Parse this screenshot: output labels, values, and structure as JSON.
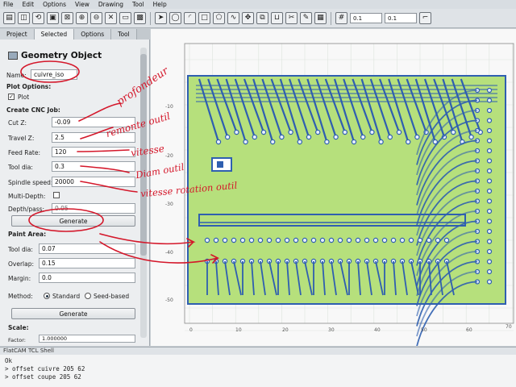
{
  "menu": [
    "File",
    "Edit",
    "Options",
    "View",
    "Drawing",
    "Tool",
    "Help"
  ],
  "toolbar": {
    "field_1": "0.1",
    "field_2": "0.1"
  },
  "tabs": [
    "Project",
    "Selected",
    "Options",
    "Tool"
  ],
  "panel": {
    "title": "Geometry Object",
    "name_label": "Name:",
    "name_value": "cuivre_iso",
    "plot_options": "Plot Options:",
    "plot_label": "Plot",
    "create_cnc": "Create CNC Job:",
    "cut_z_label": "Cut Z:",
    "cut_z": "-0.09",
    "travel_z_label": "Travel Z:",
    "travel_z": "2.5",
    "feed_rate_label": "Feed Rate:",
    "feed_rate": "120",
    "tool_dia_label": "Tool dia:",
    "tool_dia": "0.3",
    "spindle_label": "Spindle speed:",
    "spindle": "20000",
    "multidepth_label": "Multi-Depth:",
    "depth_pass_label": "Depth/pass:",
    "depth_pass": "0.05",
    "generate_label": "Generate",
    "paint_area": "Paint Area:",
    "paint_tool_dia_label": "Tool dia:",
    "paint_tool_dia": "0.07",
    "overlap_label": "Overlap:",
    "overlap": "0.15",
    "margin_label": "Margin:",
    "margin": "0.0",
    "method_label": "Method:",
    "method_standard": "Standard",
    "method_seed": "Seed-based",
    "generate2_label": "Generate",
    "scale": "Scale:",
    "factor_label": "Factor:",
    "factor": "1.000000"
  },
  "canvas": {
    "y_ticks": [
      "-10",
      "-20",
      "-30",
      "-40",
      "-50"
    ],
    "x_ticks": [
      "0",
      "10",
      "20",
      "30",
      "40",
      "50",
      "60",
      "70"
    ],
    "board_color": "#b6e07c",
    "trace_color": "#2f5fb0"
  },
  "shell": {
    "title": "FlatCAM TCL Shell",
    "lines": [
      "Ok",
      "> offset cuivre 205 62",
      "> offset coupe 205 62"
    ]
  },
  "annotations": {
    "a1": "profondeur",
    "a2": "remonte outil",
    "a3": "vitesse",
    "a4": "Diam outil",
    "a5": "vitesse rotation outil"
  },
  "colors": {
    "annotation": "#d4172a",
    "toolbar_bg": "#dfe3e7"
  }
}
